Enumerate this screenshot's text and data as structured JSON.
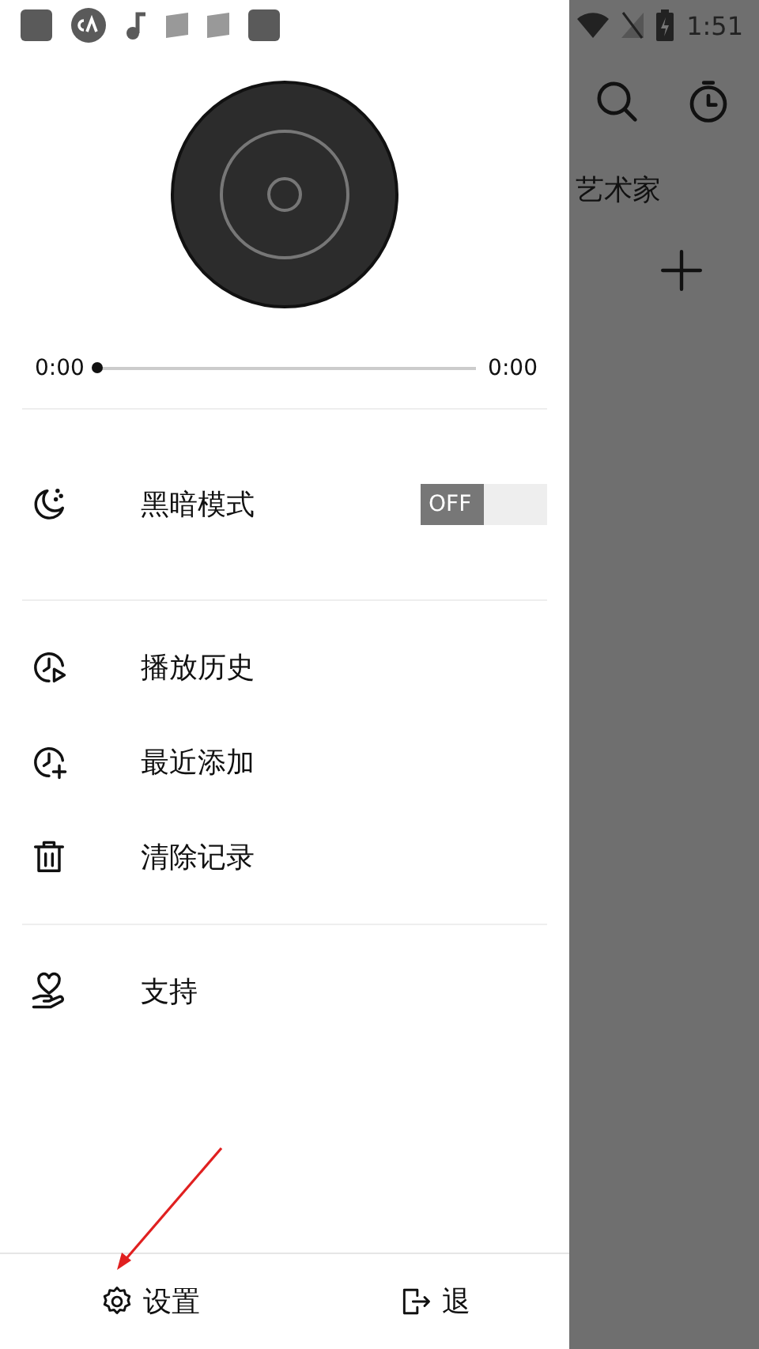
{
  "status_bar": {
    "time": "1:51"
  },
  "player": {
    "elapsed": "0:00",
    "total": "0:00",
    "level": 0
  },
  "dark_mode": {
    "label": "黑暗模式",
    "toggle_text": "OFF",
    "on": false
  },
  "menu_groups": [
    [
      {
        "kind": "history",
        "label": "播放历史"
      },
      {
        "kind": "recent",
        "label": "最近添加"
      },
      {
        "kind": "clear",
        "label": "清除记录"
      }
    ],
    [
      {
        "kind": "support",
        "label": "支持"
      }
    ]
  ],
  "bottom_bar": [
    {
      "kind": "settings",
      "label": "设置"
    },
    {
      "kind": "exit",
      "label": "退"
    }
  ],
  "background": {
    "tab": "艺术家"
  }
}
